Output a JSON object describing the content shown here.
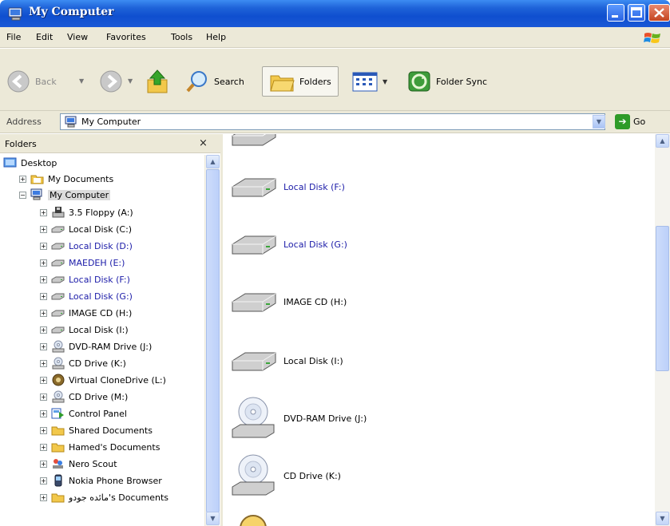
{
  "window": {
    "title": "My Computer"
  },
  "menu": [
    "File",
    "Edit",
    "View",
    "Favorites",
    "Tools",
    "Help"
  ],
  "toolbar": {
    "back_label": "Back",
    "search_label": "Search",
    "folders_label": "Folders",
    "folder_sync_label": "Folder Sync"
  },
  "address": {
    "label": "Address",
    "value": "My Computer",
    "go_label": "Go"
  },
  "folders_pane": {
    "title": "Folders",
    "close_glyph": "×",
    "tree": [
      {
        "label": "Desktop"
      },
      {
        "label": "My Documents"
      },
      {
        "label": "My Computer"
      },
      {
        "label": "3.5 Floppy (A:)"
      },
      {
        "label": "Local Disk (C:)"
      },
      {
        "label": "Local Disk (D:)"
      },
      {
        "label": "MAEDEH (E:)"
      },
      {
        "label": "Local Disk (F:)"
      },
      {
        "label": "Local Disk (G:)"
      },
      {
        "label": "IMAGE CD (H:)"
      },
      {
        "label": "Local Disk (I:)"
      },
      {
        "label": "DVD-RAM Drive (J:)"
      },
      {
        "label": "CD Drive (K:)"
      },
      {
        "label": "Virtual CloneDrive (L:)"
      },
      {
        "label": "CD Drive (M:)"
      },
      {
        "label": "Control Panel"
      },
      {
        "label": "Shared Documents"
      },
      {
        "label": "Hamed's Documents"
      },
      {
        "label": "Nero Scout"
      },
      {
        "label": "Nokia Phone Browser"
      },
      {
        "label": "مائده جودو's Documents"
      }
    ]
  },
  "content": {
    "items": [
      {
        "label": "Local Disk (F:)",
        "icon": "hard-disk-icon"
      },
      {
        "label": "Local Disk (G:)",
        "icon": "hard-disk-icon"
      },
      {
        "label": "IMAGE CD (H:)",
        "icon": "hard-disk-icon"
      },
      {
        "label": "Local Disk (I:)",
        "icon": "hard-disk-icon"
      },
      {
        "label": "DVD-RAM Drive (J:)",
        "icon": "optical-drive-icon"
      },
      {
        "label": "CD Drive (K:)",
        "icon": "optical-drive-icon"
      }
    ]
  },
  "colors": {
    "title_bar": "#1e62d8",
    "chrome": "#ece9d8",
    "link_text": "#1b1ba8",
    "close_button": "#c44520"
  }
}
